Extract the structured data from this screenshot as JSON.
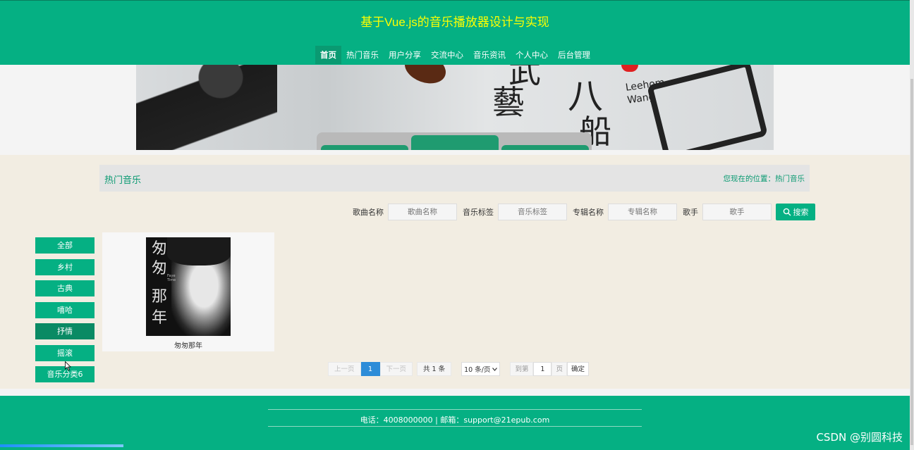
{
  "header": {
    "title": "基于Vue.js的音乐播放器设计与实现",
    "nav": [
      {
        "label": "首页",
        "active": true
      },
      {
        "label": "热门音乐",
        "active": false
      },
      {
        "label": "用户分享",
        "active": false
      },
      {
        "label": "交流中心",
        "active": false
      },
      {
        "label": "音乐资讯",
        "active": false
      },
      {
        "label": "个人中心",
        "active": false
      },
      {
        "label": "后台管理",
        "active": false
      }
    ]
  },
  "banner": {
    "calligraphy": [
      "武",
      "藝",
      "八",
      "船"
    ],
    "artist_text": [
      "Leehom",
      "Wang"
    ]
  },
  "breadcrumb": {
    "section_title": "热门音乐",
    "location": "您现在的位置：热门音乐"
  },
  "search": {
    "song_label": "歌曲名称",
    "song_placeholder": "歌曲名称",
    "tag_label": "音乐标签",
    "tag_placeholder": "音乐标签",
    "album_label": "专辑名称",
    "album_placeholder": "专辑名称",
    "singer_label": "歌手",
    "singer_placeholder": "歌手",
    "button_label": "搜索"
  },
  "categories": [
    {
      "label": "全部",
      "active": false
    },
    {
      "label": "乡村",
      "active": false
    },
    {
      "label": "古典",
      "active": false
    },
    {
      "label": "嘻哈",
      "active": false
    },
    {
      "label": "抒情",
      "active": true
    },
    {
      "label": "摇滚",
      "active": false
    },
    {
      "label": "音乐分类6",
      "active": false
    }
  ],
  "songs": [
    {
      "title": "匆匆那年",
      "cover_chars": [
        "匆",
        "匆",
        "那",
        "年"
      ],
      "cover_small": [
        "Faye",
        "Time"
      ]
    }
  ],
  "pager": {
    "prev": "上一页",
    "current": "1",
    "next": "下一页",
    "total": "共 1 条",
    "page_size": "10 条/页",
    "goto_label": "到第",
    "goto_value": "1",
    "page_unit": "页",
    "confirm": "确定"
  },
  "footer": {
    "contact": "电话：4008000000 | 邮箱：support@21epub.com"
  },
  "watermark": "CSDN @别圆科技",
  "colors": {
    "primary": "#05b083",
    "title_yellow": "#ffff00",
    "active_blue": "#2d8cd8"
  }
}
